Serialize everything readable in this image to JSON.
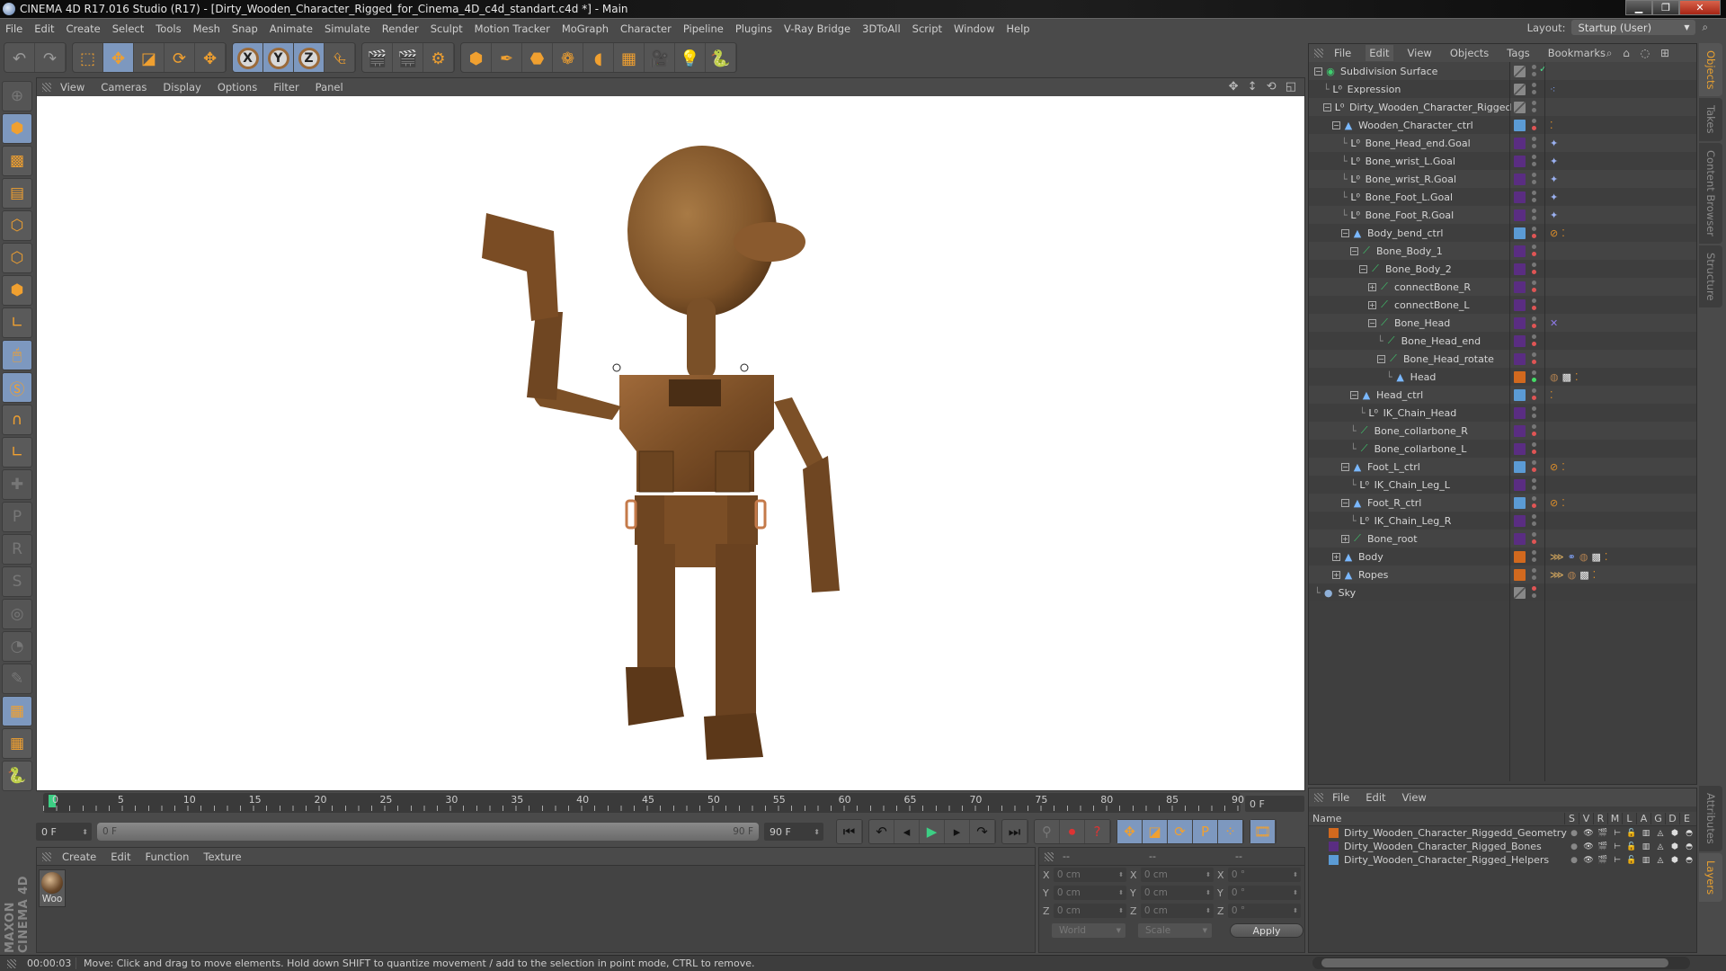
{
  "window": {
    "title": "CINEMA 4D R17.016 Studio (R17) - [Dirty_Wooden_Character_Rigged_for_Cinema_4D_c4d_standart.c4d *] - Main",
    "minimize": "▁",
    "restore": "❐",
    "close": "✕"
  },
  "menubar": [
    "File",
    "Edit",
    "Create",
    "Select",
    "Tools",
    "Mesh",
    "Snap",
    "Animate",
    "Simulate",
    "Render",
    "Sculpt",
    "Motion Tracker",
    "MoGraph",
    "Character",
    "Pipeline",
    "Plugins",
    "V-Ray Bridge",
    "3DToAll",
    "Script",
    "Window",
    "Help"
  ],
  "layout": {
    "label": "Layout:",
    "value": "Startup (User)"
  },
  "toolbar": {
    "history": [
      {
        "name": "undo",
        "glyph": "↶"
      },
      {
        "name": "redo",
        "glyph": "↷"
      }
    ],
    "modes": [
      {
        "name": "live-selection",
        "glyph": "⬚"
      },
      {
        "name": "move",
        "glyph": "✥",
        "active": true
      },
      {
        "name": "scale",
        "glyph": "◪"
      },
      {
        "name": "rotate",
        "glyph": "⟳"
      },
      {
        "name": "recent-tool",
        "glyph": "✥"
      }
    ],
    "axes": [
      "X",
      "Y",
      "Z"
    ],
    "coord_system": "⮴",
    "render": [
      {
        "name": "render-view",
        "glyph": "🎬"
      },
      {
        "name": "render-picture-viewer",
        "glyph": "🎬"
      },
      {
        "name": "edit-render-settings",
        "glyph": "⚙"
      }
    ],
    "create": [
      {
        "name": "cube",
        "glyph": "⬢"
      },
      {
        "name": "pen",
        "glyph": "✒"
      },
      {
        "name": "subdivision",
        "glyph": "⬣"
      },
      {
        "name": "cloner",
        "glyph": "❁"
      },
      {
        "name": "deformer",
        "glyph": "◖"
      },
      {
        "name": "floor",
        "glyph": "▦"
      },
      {
        "name": "camera",
        "glyph": "🎥"
      },
      {
        "name": "light",
        "glyph": "💡"
      },
      {
        "name": "python",
        "glyph": "🐍"
      }
    ]
  },
  "left_tools": [
    {
      "name": "make-editable",
      "glyph": "⊕",
      "state": "dim"
    },
    {
      "name": "model-mode",
      "glyph": "⬢",
      "state": "on"
    },
    {
      "name": "texture-mode",
      "glyph": "▩"
    },
    {
      "name": "workplane-mode",
      "glyph": "▤"
    },
    {
      "name": "points-mode",
      "glyph": "⬡"
    },
    {
      "name": "edges-mode",
      "glyph": "⬡"
    },
    {
      "name": "polygons-mode",
      "glyph": "⬢"
    },
    {
      "name": "axis-mode",
      "glyph": "∟"
    },
    {
      "name": "tweak-mode",
      "glyph": "🖱",
      "state": "on"
    },
    {
      "name": "snapping",
      "glyph": "Ⓢ",
      "state": "on"
    },
    {
      "name": "magnet",
      "glyph": "∩"
    },
    {
      "name": "locked-workplane",
      "glyph": "∟"
    },
    {
      "name": "add-key",
      "glyph": "✚",
      "state": "dim"
    },
    {
      "name": "key-position",
      "glyph": "P",
      "state": "dim"
    },
    {
      "name": "key-rotation",
      "glyph": "R",
      "state": "dim"
    },
    {
      "name": "key-psr",
      "glyph": "S",
      "state": "dim"
    },
    {
      "name": "key-point",
      "glyph": "◎",
      "state": "dim"
    },
    {
      "name": "key-param",
      "glyph": "◔",
      "state": "dim"
    },
    {
      "name": "key-pla",
      "glyph": "✎",
      "state": "dim"
    },
    {
      "name": "workplane-lock",
      "glyph": "▦",
      "state": "on"
    },
    {
      "name": "workplane-align",
      "glyph": "▦"
    },
    {
      "name": "python-script",
      "glyph": "🐍"
    }
  ],
  "brand": "MAXON CINEMA 4D",
  "viewport": {
    "menu": [
      "View",
      "Cameras",
      "Display",
      "Options",
      "Filter",
      "Panel"
    ],
    "nav_icons": "✥ ↕ ⟲ ◱"
  },
  "object_manager": {
    "menu": [
      "File",
      "Edit",
      "View",
      "Objects",
      "Tags",
      "Bookmarks"
    ],
    "active_menu": "Edit",
    "nav_icons": "⌕ ⌂ ◌ ⊞",
    "objects": [
      {
        "name": "Subdivision Surface",
        "depth": 0,
        "expander": "minus",
        "type": "subdivision",
        "layer": "none",
        "dots": [
          "gray",
          "check"
        ],
        "tags": []
      },
      {
        "name": "Expression",
        "depth": 1,
        "expander": "none",
        "type": "null",
        "layer": "none",
        "dots": [
          "gray",
          "gray"
        ],
        "tags": [
          "xpresso"
        ]
      },
      {
        "name": "Dirty_Wooden_Character_Rigged",
        "depth": 1,
        "expander": "minus",
        "type": "null",
        "layer": "none",
        "dots": [
          "gray",
          "gray"
        ],
        "tags": []
      },
      {
        "name": "Wooden_Character_ctrl",
        "depth": 2,
        "expander": "minus",
        "type": "ctrl",
        "layer": "helpers",
        "dots": [
          "gray",
          "red"
        ],
        "tags": [
          "protection-balls"
        ]
      },
      {
        "name": "Bone_Head_end.Goal",
        "depth": 3,
        "expander": "none",
        "type": "null",
        "layer": "bones",
        "dots": [
          "gray",
          "gray"
        ],
        "tags": [
          "ik-goal"
        ]
      },
      {
        "name": "Bone_wrist_L.Goal",
        "depth": 3,
        "expander": "none",
        "type": "null",
        "layer": "bones",
        "dots": [
          "gray",
          "gray"
        ],
        "tags": [
          "ik-goal"
        ]
      },
      {
        "name": "Bone_wrist_R.Goal",
        "depth": 3,
        "expander": "none",
        "type": "null",
        "layer": "bones",
        "dots": [
          "gray",
          "gray"
        ],
        "tags": [
          "ik-goal"
        ]
      },
      {
        "name": "Bone_Foot_L.Goal",
        "depth": 3,
        "expander": "none",
        "type": "null",
        "layer": "bones",
        "dots": [
          "gray",
          "gray"
        ],
        "tags": [
          "ik-goal"
        ]
      },
      {
        "name": "Bone_Foot_R.Goal",
        "depth": 3,
        "expander": "none",
        "type": "null",
        "layer": "bones",
        "dots": [
          "gray",
          "gray"
        ],
        "tags": [
          "ik-goal"
        ]
      },
      {
        "name": "Body_bend_ctrl",
        "depth": 3,
        "expander": "minus",
        "type": "ctrl",
        "layer": "helpers",
        "dots": [
          "gray",
          "red"
        ],
        "tags": [
          "restrict",
          "protection-balls"
        ]
      },
      {
        "name": "Bone_Body_1",
        "depth": 4,
        "expander": "minus",
        "type": "bone",
        "layer": "bones",
        "dots": [
          "gray",
          "red"
        ],
        "tags": []
      },
      {
        "name": "Bone_Body_2",
        "depth": 5,
        "expander": "minus",
        "type": "bone",
        "layer": "bones",
        "dots": [
          "gray",
          "red"
        ],
        "tags": []
      },
      {
        "name": "connectBone_R",
        "depth": 6,
        "expander": "plus",
        "type": "bone",
        "layer": "bones",
        "dots": [
          "gray",
          "red"
        ],
        "tags": []
      },
      {
        "name": "connectBone_L",
        "depth": 6,
        "expander": "plus",
        "type": "bone",
        "layer": "bones",
        "dots": [
          "gray",
          "red"
        ],
        "tags": []
      },
      {
        "name": "Bone_Head",
        "depth": 6,
        "expander": "minus",
        "type": "bone",
        "layer": "bones",
        "dots": [
          "gray",
          "red"
        ],
        "tags": [
          "ik"
        ]
      },
      {
        "name": "Bone_Head_end",
        "depth": 7,
        "expander": "none",
        "type": "bone",
        "layer": "bones",
        "dots": [
          "gray",
          "red"
        ],
        "tags": []
      },
      {
        "name": "Bone_Head_rotate",
        "depth": 7,
        "expander": "minus",
        "type": "bone",
        "layer": "bones",
        "dots": [
          "gray",
          "red"
        ],
        "tags": []
      },
      {
        "name": "Head",
        "depth": 8,
        "expander": "none",
        "type": "poly",
        "layer": "geometry",
        "dots": [
          "gray",
          "green"
        ],
        "tags": [
          "material",
          "uvw",
          "protection-balls"
        ]
      },
      {
        "name": "Head_ctrl",
        "depth": 4,
        "expander": "minus",
        "type": "ctrl",
        "layer": "helpers",
        "dots": [
          "gray",
          "red"
        ],
        "tags": [
          "protection-balls"
        ]
      },
      {
        "name": "IK_Chain_Head",
        "depth": 5,
        "expander": "none",
        "type": "null",
        "layer": "bones",
        "dots": [
          "gray",
          "gray"
        ],
        "tags": []
      },
      {
        "name": "Bone_collarbone_R",
        "depth": 4,
        "expander": "none",
        "type": "bone",
        "layer": "bones",
        "dots": [
          "gray",
          "red"
        ],
        "tags": []
      },
      {
        "name": "Bone_collarbone_L",
        "depth": 4,
        "expander": "none",
        "type": "bone",
        "layer": "bones",
        "dots": [
          "gray",
          "red"
        ],
        "tags": []
      },
      {
        "name": "Foot_L_ctrl",
        "depth": 3,
        "expander": "minus",
        "type": "ctrl",
        "layer": "helpers",
        "dots": [
          "gray",
          "red"
        ],
        "tags": [
          "restrict",
          "protection-balls"
        ]
      },
      {
        "name": "IK_Chain_Leg_L",
        "depth": 4,
        "expander": "none",
        "type": "null",
        "layer": "bones",
        "dots": [
          "gray",
          "gray"
        ],
        "tags": []
      },
      {
        "name": "Foot_R_ctrl",
        "depth": 3,
        "expander": "minus",
        "type": "ctrl",
        "layer": "helpers",
        "dots": [
          "gray",
          "red"
        ],
        "tags": [
          "restrict",
          "protection-balls"
        ]
      },
      {
        "name": "IK_Chain_Leg_R",
        "depth": 4,
        "expander": "none",
        "type": "null",
        "layer": "bones",
        "dots": [
          "gray",
          "gray"
        ],
        "tags": []
      },
      {
        "name": "Bone_root",
        "depth": 3,
        "expander": "plus",
        "type": "bone",
        "layer": "bones",
        "dots": [
          "gray",
          "red"
        ],
        "tags": []
      },
      {
        "name": "Body",
        "depth": 2,
        "expander": "plus",
        "type": "poly",
        "layer": "geometry",
        "dots": [
          "gray",
          "gray"
        ],
        "tags": [
          "weight",
          "skin",
          "material",
          "uvw",
          "protection-balls"
        ]
      },
      {
        "name": "Ropes",
        "depth": 2,
        "expander": "plus",
        "type": "poly",
        "layer": "geometry",
        "dots": [
          "gray",
          "gray"
        ],
        "tags": [
          "weight",
          "material",
          "uvw",
          "protection-balls"
        ]
      },
      {
        "name": "Sky",
        "depth": 0,
        "expander": "none",
        "type": "sky",
        "layer": "none",
        "dots": [
          "red",
          "gray"
        ],
        "tags": []
      }
    ]
  },
  "side_tabs_top": [
    {
      "label": "Objects",
      "active": true
    },
    {
      "label": "Takes"
    },
    {
      "label": "Content Browser"
    },
    {
      "label": "Structure"
    }
  ],
  "side_tabs_bottom": [
    {
      "label": "Attributes"
    },
    {
      "label": "Layers",
      "active": true
    }
  ],
  "colors": {
    "helpers": "#5b9bd5",
    "bones": "#5a2d82",
    "geometry": "#d2691e",
    "accent": "#e8a030",
    "selection": "#7d98bf",
    "playhead": "#3ccf84"
  },
  "timeline": {
    "ticks": [
      0,
      5,
      10,
      15,
      20,
      25,
      30,
      35,
      40,
      45,
      50,
      55,
      60,
      65,
      70,
      75,
      80,
      85,
      90
    ],
    "current_frame": "0 F",
    "start": "0 F",
    "range_start": "0 F",
    "range_end": "90 F",
    "end": "90 F",
    "playhead_frame": 0,
    "max_frame": 90
  },
  "transport": {
    "nav": [
      {
        "name": "go-to-start",
        "glyph": "⏮"
      }
    ],
    "play": [
      {
        "name": "prev-key",
        "glyph": "↶"
      },
      {
        "name": "prev-frame",
        "glyph": "◂"
      },
      {
        "name": "play",
        "glyph": "▶"
      },
      {
        "name": "next-frame",
        "glyph": "▸"
      },
      {
        "name": "next-key",
        "glyph": "↷"
      }
    ],
    "end": [
      {
        "name": "go-to-end",
        "glyph": "⏭"
      }
    ],
    "record": [
      {
        "name": "record-off",
        "glyph": "⚲"
      },
      {
        "name": "autokey",
        "glyph": "⏺"
      },
      {
        "name": "keyframe-selection",
        "glyph": "?"
      }
    ],
    "keys": [
      {
        "name": "key-position",
        "glyph": "✥"
      },
      {
        "name": "key-scale",
        "glyph": "◪"
      },
      {
        "name": "key-rotation",
        "glyph": "⟳"
      },
      {
        "name": "key-parameter",
        "glyph": "P"
      },
      {
        "name": "key-pla",
        "glyph": "⁘"
      }
    ],
    "timeline_btn": {
      "name": "timeline",
      "glyph": "🎞"
    }
  },
  "material_manager": {
    "menu": [
      "Create",
      "Edit",
      "Function",
      "Texture"
    ],
    "materials": [
      {
        "name": "Woo"
      }
    ]
  },
  "coordinates": {
    "headers": [
      "--",
      "--",
      "--"
    ],
    "position": {
      "X": "0 cm",
      "Y": "0 cm",
      "Z": "0 cm"
    },
    "size": {
      "X": "0 cm",
      "Y": "0 cm",
      "Z": "0 cm"
    },
    "rotation": {
      "X": "0 °",
      "Y": "0 °",
      "Z": "0 °"
    },
    "space": "World",
    "mode": "Scale",
    "apply": "Apply"
  },
  "layer_manager": {
    "menu": [
      "File",
      "Edit",
      "View"
    ],
    "columns": [
      "Name",
      "S",
      "V",
      "R",
      "M",
      "L",
      "A",
      "G",
      "D",
      "E"
    ],
    "layers": [
      {
        "name": "Dirty_Wooden_Character_Riggedd_Geometry",
        "color": "#d2691e"
      },
      {
        "name": "Dirty_Wooden_Character_Rigged_Bones",
        "color": "#5a2d82"
      },
      {
        "name": "Dirty_Wooden_Character_Rigged_Helpers",
        "color": "#5b9bd5"
      }
    ],
    "col_glyphs": [
      "●",
      "👁",
      "🎬",
      "⊢",
      "🔓",
      "▥",
      "◬",
      "⬢",
      "◓"
    ]
  },
  "status": {
    "time": "00:00:03",
    "message": "Move: Click and drag to move elements. Hold down SHIFT to quantize movement / add to the selection in point mode, CTRL to remove."
  }
}
